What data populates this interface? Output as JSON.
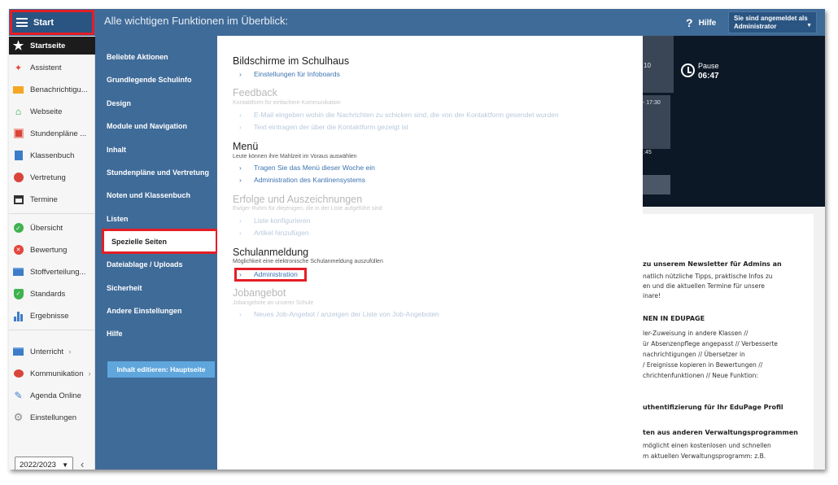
{
  "topbar": {
    "start_label": "Start",
    "title": "Alle wichtigen Funktionen im Überblick:",
    "help_label": "Hilfe",
    "login_line1": "Sie sind angemeldet als",
    "login_line2": "Administrator"
  },
  "sidebar": {
    "items": [
      {
        "label": "Startseite",
        "icon": "star-icon"
      },
      {
        "label": "Assistent",
        "icon": "magic-wand-icon"
      },
      {
        "label": "Benachrichtigu...",
        "icon": "envelope-icon"
      },
      {
        "label": "Webseite",
        "icon": "house-icon"
      },
      {
        "label": "Stundenpläne ...",
        "icon": "timetable-icon"
      },
      {
        "label": "Klassenbuch",
        "icon": "book-icon"
      },
      {
        "label": "Vertretung",
        "icon": "substitution-icon"
      },
      {
        "label": "Termine",
        "icon": "calendar-icon"
      },
      {
        "label": "Übersicht",
        "icon": "check-circle-icon"
      },
      {
        "label": "Bewertung",
        "icon": "rating-icon"
      },
      {
        "label": "Stoffverteilung...",
        "icon": "briefcase-icon"
      },
      {
        "label": "Standards",
        "icon": "shield-check-icon"
      },
      {
        "label": "Ergebnisse",
        "icon": "bar-chart-icon"
      },
      {
        "label": "Unterricht",
        "icon": "lesson-icon"
      },
      {
        "label": "Kommunikation",
        "icon": "chat-icon"
      },
      {
        "label": "Agenda Online",
        "icon": "pen-icon"
      },
      {
        "label": "Einstellungen",
        "icon": "gear-icon"
      }
    ],
    "year": "2022/2023"
  },
  "menu": {
    "items": [
      "Beliebte Aktionen",
      "Grundlegende Schulinfo",
      "Design",
      "Module und Navigation",
      "Inhalt",
      "Stundenpläne und Vertretung",
      "Noten und Klassenbuch",
      "Listen",
      "Spezielle Seiten",
      "Dateiablage / Uploads",
      "Sicherheit",
      "Andere Einstellungen",
      "Hilfe"
    ],
    "edit_button": "Inhalt editieren: Hauptseite"
  },
  "content": {
    "sections": [
      {
        "title": "Bildschirme im Schulhaus",
        "desc": "",
        "links": [
          "Einstellungen für Infoboards"
        ],
        "enabled": true
      },
      {
        "title": "Feedback",
        "desc": "Kontaktform für einfachere Kommunikation",
        "links": [
          "E-Mail eingeben wohin die Nachrichten zu schicken sind, die von der Kontaktform gesendet wurden",
          "Text eintragen der über die Kontaktform gezeigt ist"
        ],
        "enabled": false
      },
      {
        "title": "Menü",
        "desc": "Leute können ihre Mahlzeit im Voraus auswählen",
        "links": [
          "Tragen Sie das Menü dieser Woche ein",
          "Administration des Kantinensystems"
        ],
        "enabled": true
      },
      {
        "title": "Erfolge und Auszeichnungen",
        "desc": "Ewiger Ruhm für diejenigen, die in der Liste aufgeführt sind",
        "links": [
          "Liste konfigurieren",
          "Artikel hinzufügen"
        ],
        "enabled": false
      },
      {
        "title": "Schulanmeldung",
        "desc": "Möglichkeit eine elektronische Schulanmeldung auszufüllen",
        "links": [
          "Administration"
        ],
        "enabled": true
      },
      {
        "title": "Jobangebot",
        "desc": "Jobangebote an unserer Schule",
        "links": [
          "Neues Job-Angebot / anzeigen der Liste von Job-Angeboten"
        ],
        "enabled": false
      }
    ]
  },
  "dashboard": {
    "fragment_time_top": "10",
    "pause_label": "Pause",
    "pause_time": "06:47",
    "fragment_time_mid": "- 17:30",
    "fragment_time_bot": ":45"
  },
  "news": {
    "lines": [
      {
        "text": "zu unserem Newsletter für Admins an",
        "bold": true
      },
      {
        "text": "natlich nützliche Tipps, praktische Infos zu",
        "bold": false
      },
      {
        "text": "en und die aktuellen Termine für unsere",
        "bold": false
      },
      {
        "text": "inare!",
        "bold": false
      },
      {
        "text": "NEN IN EDUPAGE",
        "bold": true
      },
      {
        "text": "ler-Zuweisung in andere Klassen //",
        "bold": false
      },
      {
        "text": "ür Absenzenpflege angepasst // Verbesserte",
        "bold": false
      },
      {
        "text": "nachrichtigungen // Übersetzer in",
        "bold": false
      },
      {
        "text": "/ Ereignisse kopieren in Bewertungen //",
        "bold": false
      },
      {
        "text": "chrichtenfunktionen // Neue Funktion:",
        "bold": false
      },
      {
        "text": "uthentifizierung für Ihr EduPage Profil",
        "bold": true
      },
      {
        "text": "ten aus anderen Verwaltungsprogrammen",
        "bold": true
      },
      {
        "text": "möglicht einen kostenlosen und schnellen",
        "bold": false
      },
      {
        "text": "m aktuellen Verwaltungsprogramm: z.B.",
        "bold": false
      }
    ]
  }
}
